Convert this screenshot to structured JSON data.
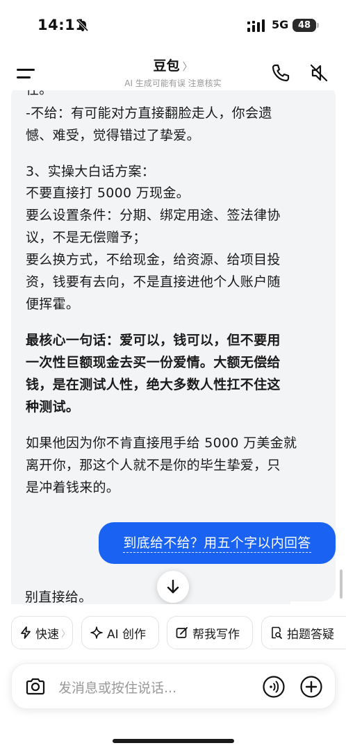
{
  "status_bar": {
    "time": "14:11",
    "network": "5G",
    "battery": "48"
  },
  "header": {
    "title": "豆包",
    "title_chevron": "〉",
    "subtitle": "AI 生成可能有误 注意核实"
  },
  "ai_message": {
    "lines": [
      "任。",
      "-不给：有可能对方直接翻脸走人，你会遗",
      "憾、难受，觉得错过了挚爱。",
      "3、实操大白话方案：",
      "不要直接打 5000 万现金。",
      "要么设置条件：分期、绑定用途、签法律协",
      "议，不是无偿赠予；",
      "要么换方式，不给现金，给资源、给项目投",
      "资，钱要有去向，不是直接进他个人账户随",
      "便挥霍。",
      "最核心一句话：爱可以，钱可以，但不要用",
      "一次性巨额现金去买一份爱情。大额无偿给",
      "钱，是在测试人性，绝大多数人性扛不住这",
      "种测试。",
      "如果他因为你不肯直接甩手给 5000 万美金就",
      "离开你，那这个人就不是你的毕生挚爱，只",
      "是冲着钱来的。"
    ]
  },
  "user_message": {
    "text": "到底给不给？用五个字以内回答"
  },
  "ai_reply": {
    "text": "别直接给。"
  },
  "chips": {
    "fast": "快速",
    "fast_arrow": "〉",
    "ai_create": "AI 创作",
    "write": "帮我写作",
    "photo": "拍题答疑"
  },
  "input": {
    "placeholder": "发消息或按住说话..."
  }
}
